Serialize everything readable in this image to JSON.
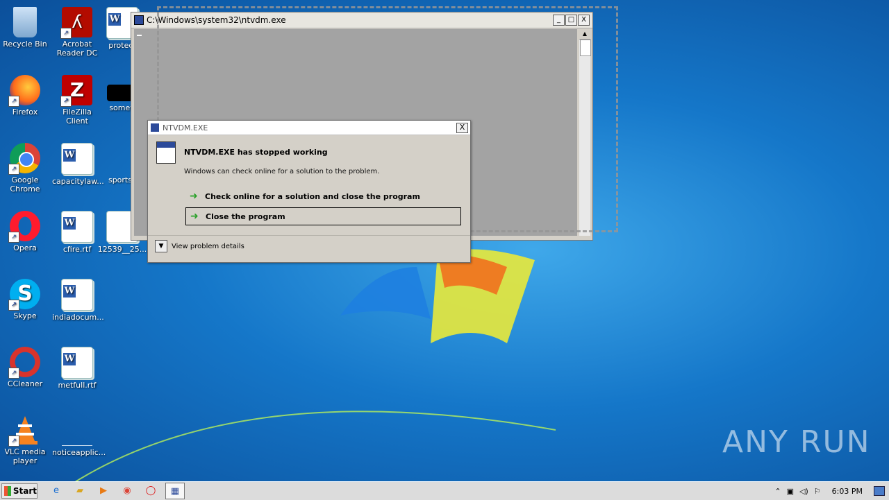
{
  "desktop": {
    "icons": [
      {
        "label": "Recycle Bin"
      },
      {
        "label": "Acrobat Reader DC"
      },
      {
        "label": "protect"
      },
      {
        "label": "Firefox"
      },
      {
        "label": "FileZilla Client"
      },
      {
        "label": "someti"
      },
      {
        "label": "Google Chrome"
      },
      {
        "label": "capacitylaw..."
      },
      {
        "label": "sportsc"
      },
      {
        "label": "Opera"
      },
      {
        "label": "cfire.rtf"
      },
      {
        "label": "12539__25..."
      },
      {
        "label": "Skype"
      },
      {
        "label": "indiadocum..."
      },
      {
        "label": "CCleaner"
      },
      {
        "label": "metfull.rtf"
      },
      {
        "label": "VLC media player"
      },
      {
        "label": "noticeapplic..."
      }
    ],
    "watermark": "ANY RUN"
  },
  "console": {
    "title": "C:\\Windows\\system32\\ntvdm.exe",
    "controls": {
      "minimize": "_",
      "maximize": "□",
      "close": "X"
    }
  },
  "dialog": {
    "title": "NTVDM.EXE",
    "heading": "NTVDM.EXE has stopped working",
    "description": "Windows can check online for a solution to the problem.",
    "option_check": "Check online for a solution and close the program",
    "option_close": "Close the program",
    "details": "View problem details",
    "close_glyph": "X"
  },
  "taskbar": {
    "start_label": "Start",
    "clock": "6:03 PM"
  }
}
